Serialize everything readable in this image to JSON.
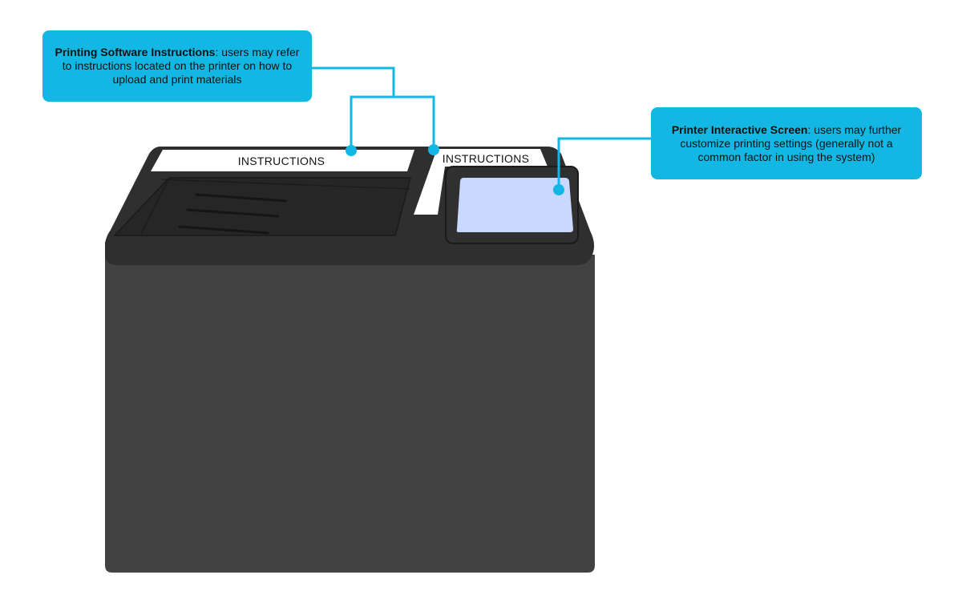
{
  "colors": {
    "accent": "#12b8e3",
    "printer_body": "#424242",
    "printer_top": "#2f2f2f",
    "screen": "#c9d8ff",
    "label_bg": "#ffffff"
  },
  "printer": {
    "label_left": "INSTRUCTIONS",
    "label_right": "INSTRUCTIONS"
  },
  "callouts": {
    "software": {
      "title": "Printing Software Instructions",
      "text": ": users may refer to instructions located on the printer on how to upload and print materials"
    },
    "screen": {
      "title": "Printer Interactive Screen",
      "text": ": users may further customize printing settings (generally not a common factor in using the system)"
    }
  }
}
